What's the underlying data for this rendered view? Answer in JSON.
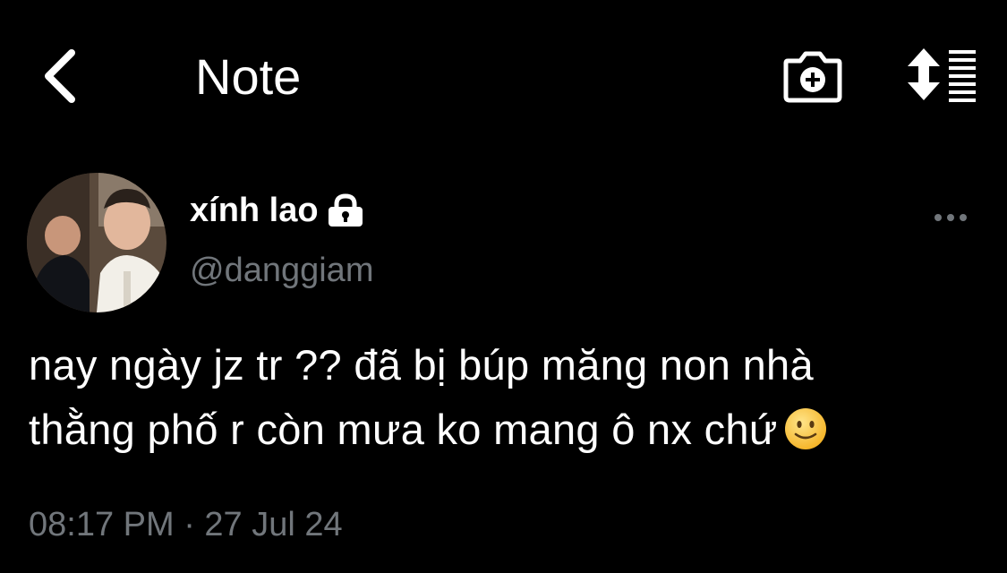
{
  "header": {
    "title": "Note",
    "back_icon": "chevron-left-icon",
    "camera_icon": "camera-plus-icon",
    "sort_icon": "sort-list-icon"
  },
  "tweet": {
    "display_name": "xính lao",
    "handle": "@danggiam",
    "line1": "nay ngày jz tr ?? đã bị búp măng non nhà",
    "line2": "thằng phố r còn mưa ko mang ô nx chứ",
    "emoji": "slightly-smiling-face-icon",
    "timestamp": "08:17 PM · 27 Jul 24",
    "protected_icon": "lock-icon",
    "more_icon": "more-horizontal-icon"
  },
  "colors": {
    "background": "#000000",
    "text_primary": "#ffffff",
    "text_secondary": "#71767b"
  }
}
